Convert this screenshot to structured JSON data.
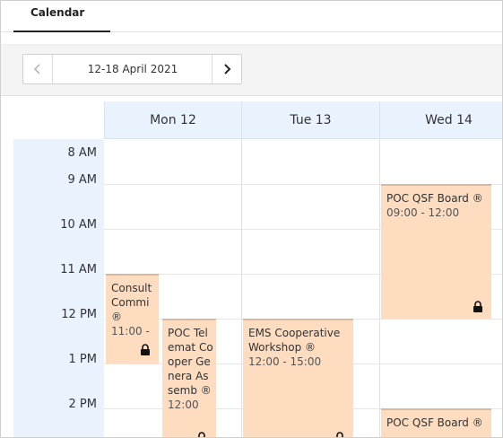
{
  "tab": {
    "label": "Calendar"
  },
  "nav": {
    "range": "12-18 April 2021"
  },
  "days": [
    {
      "label": "Mon 12"
    },
    {
      "label": "Tue 13"
    },
    {
      "label": "Wed 14"
    }
  ],
  "times": [
    "8 AM",
    "9 AM",
    "10 AM",
    "11 AM",
    "12 PM",
    "1 PM",
    "2 PM"
  ],
  "events": [
    {
      "title": "Consult Commi ®",
      "time": "11:00 -",
      "locked": true
    },
    {
      "title": "POC Telemat Cooper Genera Assemb ®",
      "time": "12:00",
      "locked": true
    },
    {
      "title": "EMS Cooperative Workshop ®",
      "time": "12:00 - 15:00",
      "locked": true
    },
    {
      "title": "POC QSF Board ®",
      "time": "09:00 - 12:00",
      "locked": true
    },
    {
      "title": "POC QSF Board ®",
      "time": "",
      "locked": false
    }
  ],
  "colors": {
    "event": "#fddcc0",
    "header": "#eaf2fd",
    "accent": "#222222"
  }
}
